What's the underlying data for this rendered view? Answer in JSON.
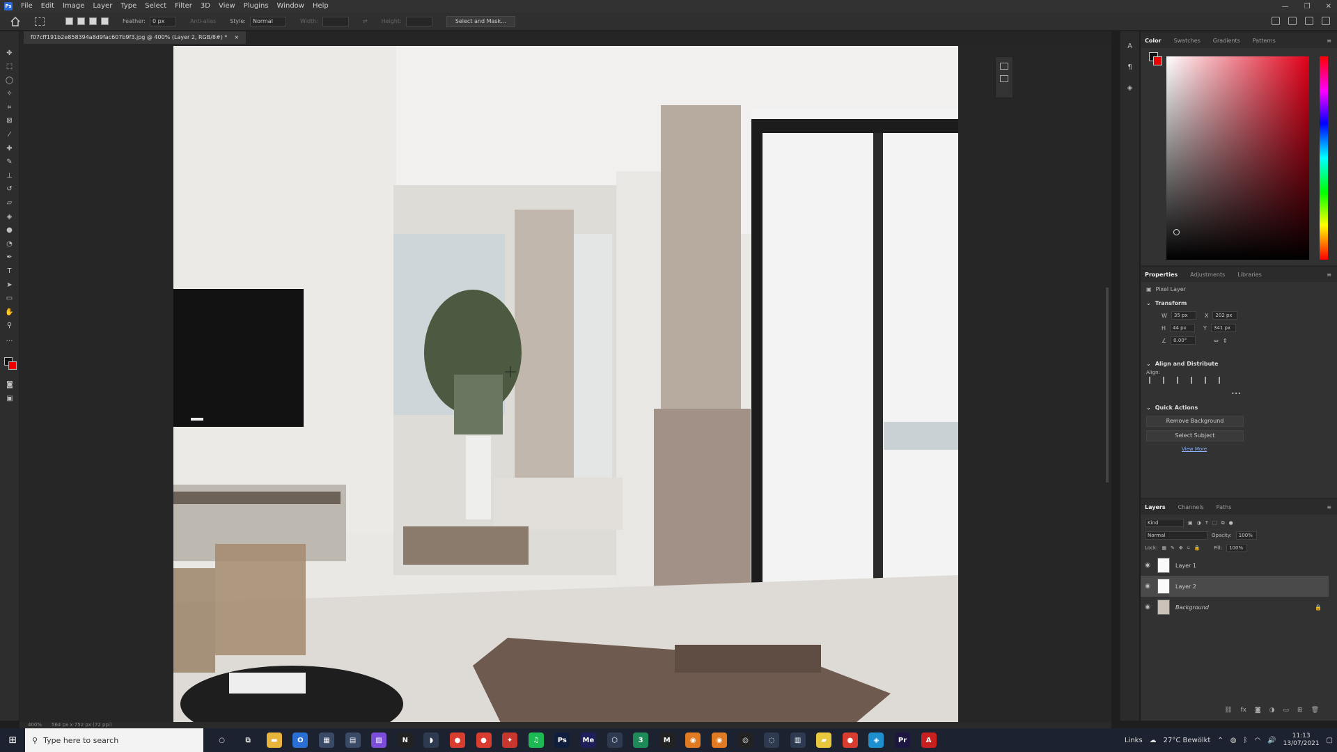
{
  "menu": {
    "items": [
      "File",
      "Edit",
      "Image",
      "Layer",
      "Type",
      "Select",
      "Filter",
      "3D",
      "View",
      "Plugins",
      "Window",
      "Help"
    ]
  },
  "options_bar": {
    "feather_label": "Feather:",
    "feather_value": "0 px",
    "antialias_label": "Anti-alias",
    "style_label": "Style:",
    "style_value": "Normal",
    "width_label": "Width:",
    "height_label": "Height:",
    "select_mask_button": "Select and Mask..."
  },
  "document": {
    "tab_title": "f07cff191b2e858394a8d9fac607b9f3.jpg @ 400% (Layer 2, RGB/8#) *",
    "close_glyph": "×",
    "zoom": "400%",
    "doc_info": "564 px x 752 px (72 ppi)"
  },
  "color_panel": {
    "tabs": [
      "Color",
      "Swatches",
      "Gradients",
      "Patterns"
    ],
    "foreground": "#111111",
    "background": "#e00000"
  },
  "properties_panel": {
    "tabs": [
      "Properties",
      "Adjustments",
      "Libraries"
    ],
    "layer_type": "Pixel Layer",
    "transform_label": "Transform",
    "w_label": "W",
    "w_value": "35 px",
    "h_label": "H",
    "h_value": "44 px",
    "x_label": "X",
    "x_value": "202 px",
    "y_label": "Y",
    "y_value": "341 px",
    "angle_value": "0.00°",
    "align_label": "Align and Distribute",
    "align_sub": "Align:",
    "quick_actions_label": "Quick Actions",
    "remove_bg_button": "Remove Background",
    "select_subject_button": "Select Subject",
    "view_more_link": "View More"
  },
  "layers_panel": {
    "tabs": [
      "Layers",
      "Channels",
      "Paths"
    ],
    "filter_kind": "Kind",
    "blend_mode": "Normal",
    "opacity_label": "Opacity:",
    "opacity_value": "100%",
    "lock_label": "Lock:",
    "fill_label": "Fill:",
    "fill_value": "100%",
    "layers": [
      {
        "name": "Layer 1",
        "selected": false
      },
      {
        "name": "Layer 2",
        "selected": true
      },
      {
        "name": "Background",
        "selected": false
      }
    ]
  },
  "taskbar": {
    "search_placeholder": "Type here to search",
    "apps": [
      {
        "icon": "file-explorer-icon",
        "color": "#e8b43c",
        "glyph": "▬"
      },
      {
        "icon": "outlook-icon",
        "color": "#2a6fd4",
        "glyph": "O"
      },
      {
        "icon": "calculator-icon",
        "color": "#3a4a66",
        "glyph": "▦"
      },
      {
        "icon": "app-icon",
        "color": "#3a4a66",
        "glyph": "▤"
      },
      {
        "icon": "paint-icon",
        "color": "#7c4dd8",
        "glyph": "▨"
      },
      {
        "icon": "notion-icon",
        "color": "#222222",
        "glyph": "N"
      },
      {
        "icon": "app-icon",
        "color": "#2d3a50",
        "glyph": "◗"
      },
      {
        "icon": "chrome-icon",
        "color": "#d93d2f",
        "glyph": "●"
      },
      {
        "icon": "chrome-icon",
        "color": "#d93d2f",
        "glyph": "●"
      },
      {
        "icon": "app-icon",
        "color": "#c8372d",
        "glyph": "✦"
      },
      {
        "icon": "spotify-icon",
        "color": "#1db954",
        "glyph": "♫"
      },
      {
        "icon": "photoshop-icon",
        "color": "#0f1e3c",
        "glyph": "Ps"
      },
      {
        "icon": "media-encoder-icon",
        "color": "#1e1e5a",
        "glyph": "Me"
      },
      {
        "icon": "app-icon",
        "color": "#2d3a50",
        "glyph": "⬡"
      },
      {
        "icon": "app-icon",
        "color": "#1e8a5a",
        "glyph": "3"
      },
      {
        "icon": "app-icon",
        "color": "#222222",
        "glyph": "M"
      },
      {
        "icon": "blender-icon",
        "color": "#e07b23",
        "glyph": "◉"
      },
      {
        "icon": "blender-icon",
        "color": "#e07b23",
        "glyph": "◉"
      },
      {
        "icon": "app-icon",
        "color": "#222222",
        "glyph": "◎"
      },
      {
        "icon": "app-icon",
        "color": "#2d3a50",
        "glyph": "◌"
      },
      {
        "icon": "app-icon",
        "color": "#2d3a50",
        "glyph": "▥"
      },
      {
        "icon": "sticky-notes-icon",
        "color": "#e8c83c",
        "glyph": "▰"
      },
      {
        "icon": "chrome-icon",
        "color": "#d93d2f",
        "glyph": "●"
      },
      {
        "icon": "app-icon",
        "color": "#1d8fcf",
        "glyph": "◈"
      },
      {
        "icon": "premiere-icon",
        "color": "#1c1640",
        "glyph": "Pr"
      },
      {
        "icon": "acrobat-icon",
        "color": "#c8201e",
        "glyph": "A"
      }
    ],
    "links_label": "Links",
    "weather": "27°C Bewölkt",
    "time": "11:13",
    "date": "13/07/2021"
  }
}
